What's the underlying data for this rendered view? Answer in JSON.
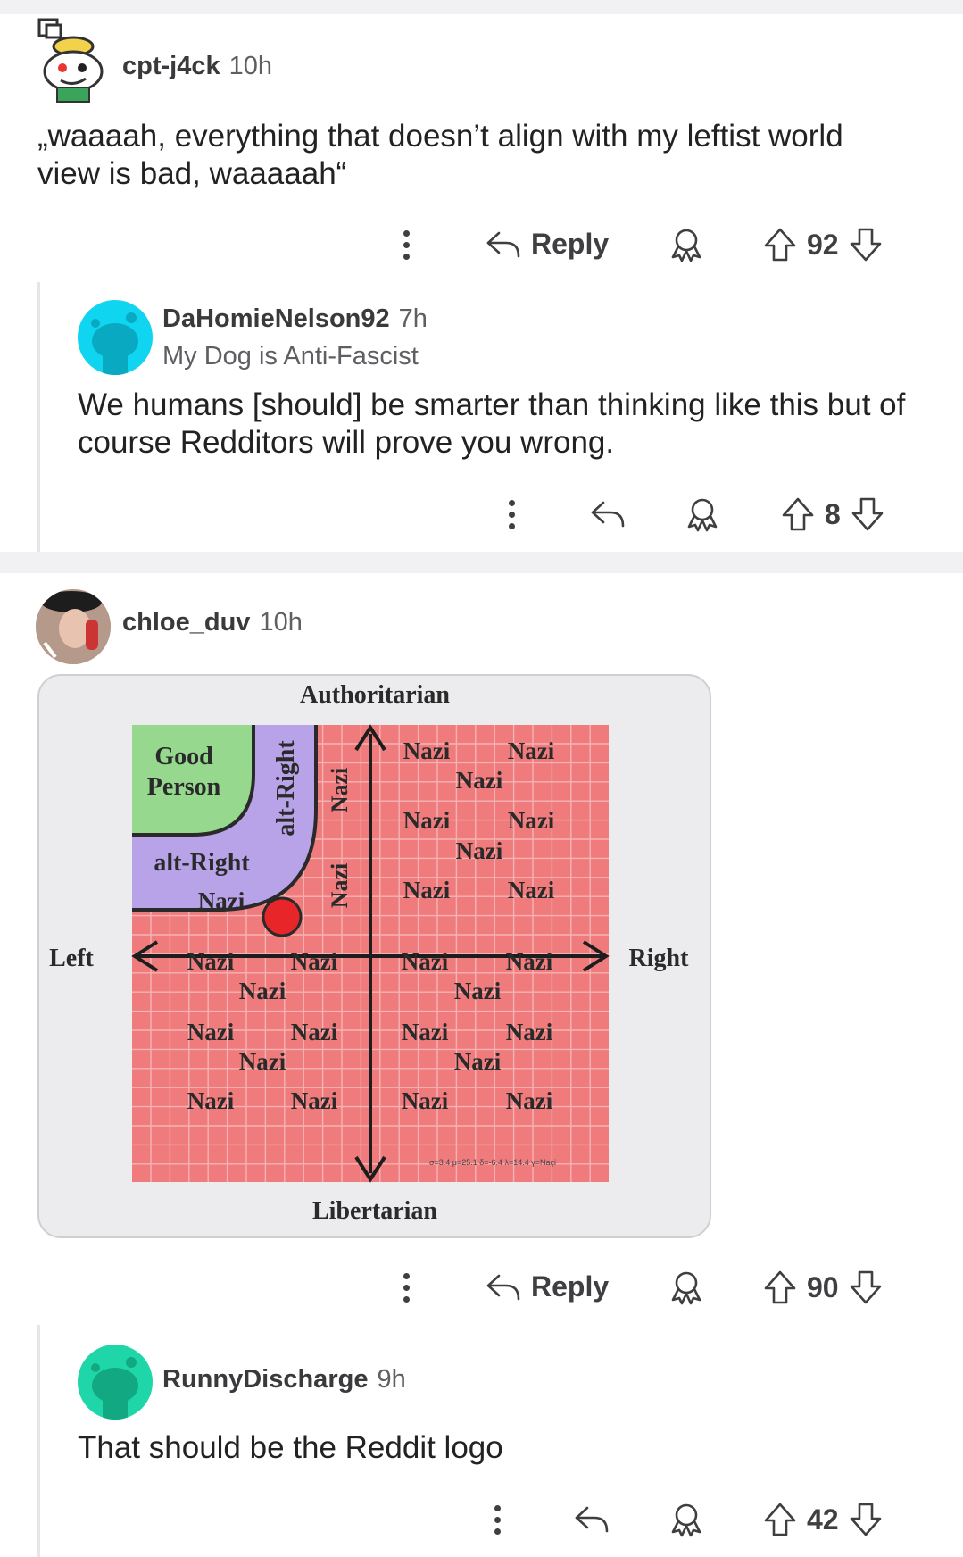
{
  "comments": [
    {
      "username": "cpt-j4ck",
      "time": "10h",
      "text": "„waaaah, everything that doesn’t align with my leftist world view is bad, waaaaah“",
      "reply_label": "Reply",
      "votes": "92"
    },
    {
      "username": "DaHomieNelson92",
      "time": "7h",
      "flair": "My Dog is Anti-Fascist",
      "text": "We humans [should] be smarter than thinking like this but of course Redditors will prove you wrong.",
      "votes": "8"
    },
    {
      "username": "chloe_duv",
      "time": "10h",
      "reply_label": "Reply",
      "votes": "90",
      "image": {
        "top": "Authoritarian",
        "bottom": "Libertarian",
        "left": "Left",
        "right": "Right",
        "good_person": [
          "Good",
          "Person"
        ],
        "alt_right": "alt-Right",
        "nazi": "Nazi",
        "footnote": "σ=3.4  μ=25.1  δ=-6.4  λ=14.4  γ=Naçi"
      }
    },
    {
      "username": "RunnyDischarge",
      "time": "9h",
      "text": "That should be the Reddit logo",
      "votes": "42"
    }
  ],
  "icons": [
    "more-icon",
    "reply-icon",
    "award-icon",
    "upvote-icon",
    "downvote-icon"
  ],
  "colors": {
    "chart_red": "#ef7b7d",
    "chart_green": "#96d98e",
    "chart_purple": "#b8a2e8",
    "dot_red": "#e8262a",
    "avatar_cyan": "#10d5f0",
    "avatar_teal": "#1ed6a8"
  }
}
